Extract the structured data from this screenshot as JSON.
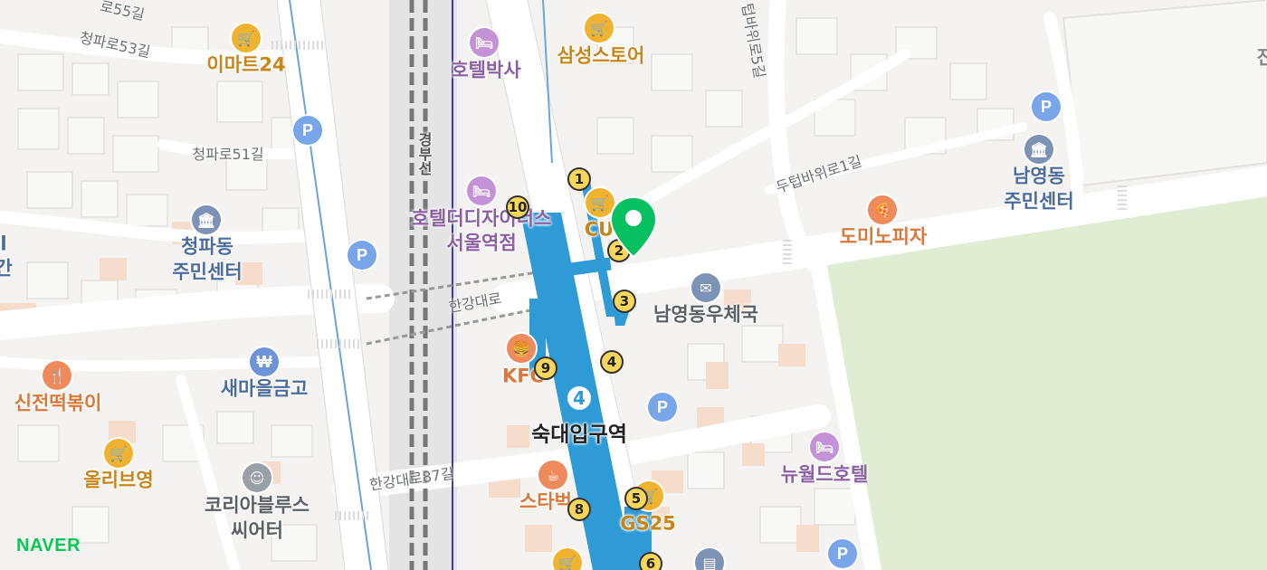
{
  "map": {
    "provider_logo": "NAVER",
    "selected_pin": "selected-location",
    "station": {
      "name": "숙대입구역",
      "line_badge": "4"
    },
    "roads": {
      "hangangdaero": "한강대로",
      "hangangdaero87": "한강대로87길",
      "cheongparo53": "청파로53길",
      "cheongparo55": "로55길",
      "cheongparo51": "청파로51길",
      "dutebawiro1": "두텁바위로1길",
      "dutebawiro5": "텁바위로5길",
      "gyeongbu": "경부선"
    },
    "places": {
      "emart24": "이마트24",
      "hotelbaksa": "호텔박사",
      "samsung": "삼성스토어",
      "cheongpa_center_1": "청파동",
      "cheongpa_center_2": "주민센터",
      "hoteldesigners_1": "호텔더디자이너스",
      "hoteldesigners_2": "서울역점",
      "cu": "CU",
      "namyeong_center_1": "남영동",
      "namyeong_center_2": "주민센터",
      "dominos": "도미노피자",
      "post": "남영동우체국",
      "saemaeul": "새마을금고",
      "sinjeon": "신전떡볶이",
      "kfc": "KFC",
      "oliveyoung": "올리브영",
      "korea_blues_1": "코리아블루스",
      "korea_blues_2": "씨어터",
      "starbucks": "스타벅",
      "gs25": "GS25",
      "newworld": "뉴월드호텔",
      "edge_left_1": "l",
      "edge_left_2": "간",
      "edge_right": "진"
    },
    "exits": [
      "1",
      "2",
      "3",
      "4",
      "5",
      "6",
      "8",
      "9",
      "10"
    ]
  }
}
